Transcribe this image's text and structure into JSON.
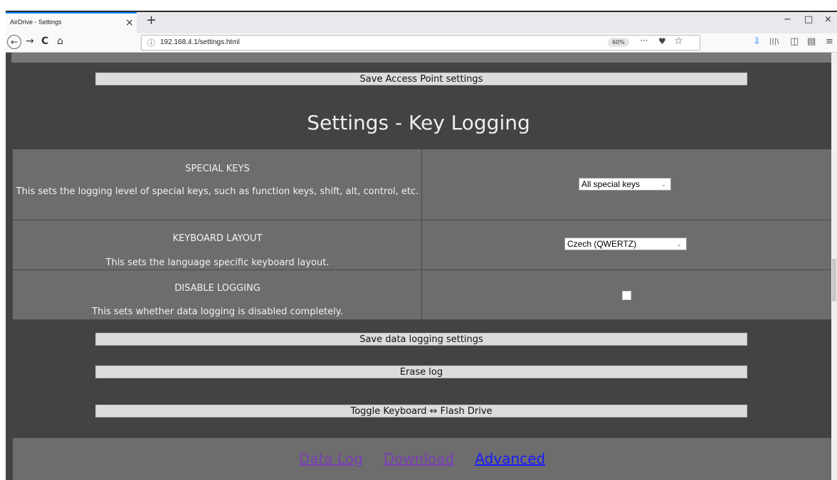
{
  "browser": {
    "tab_title": "AirDrive - Settings",
    "tab_close": "×",
    "new_tab": "+",
    "minimize": "−",
    "restore": "□",
    "close": "×",
    "back": "←",
    "forward": "→",
    "reload": "C",
    "home": "⌂",
    "url_info": "ⓘ",
    "url": "192.168.4.1/settings.html",
    "zoom": "60%",
    "more": "···",
    "pocket": "♥",
    "bookmark": "☆",
    "download": "⇩",
    "library": "|||\\",
    "sidebar": "◫",
    "reader": "▤",
    "menu": "≡"
  },
  "buttons": {
    "save_ap": "Save Access Point settings",
    "save_logging": "Save data logging settings",
    "erase_log": "Erase log",
    "toggle_mode": "Toggle Keyboard ⇔ Flash Drive"
  },
  "section": {
    "title": "Settings - Key Logging"
  },
  "settings": {
    "special_keys": {
      "heading": "SPECIAL KEYS",
      "description": "This sets the logging level of special keys, such as function keys, shift, alt, control, etc.",
      "value": "All special keys"
    },
    "keyboard_layout": {
      "heading": "KEYBOARD LAYOUT",
      "description": "This sets the language specific keyboard layout.",
      "value": "Czech (QWERTZ)"
    },
    "disable_logging": {
      "heading": "DISABLE LOGGING",
      "description": "This sets whether data logging is disabled completely.",
      "checked": false
    }
  },
  "footer": {
    "data_log": "Data Log",
    "download": "Download",
    "advanced": "Advanced",
    "visited_color": "#7a3fb5",
    "link_color": "#1a1aff"
  },
  "chevron": "⌄"
}
